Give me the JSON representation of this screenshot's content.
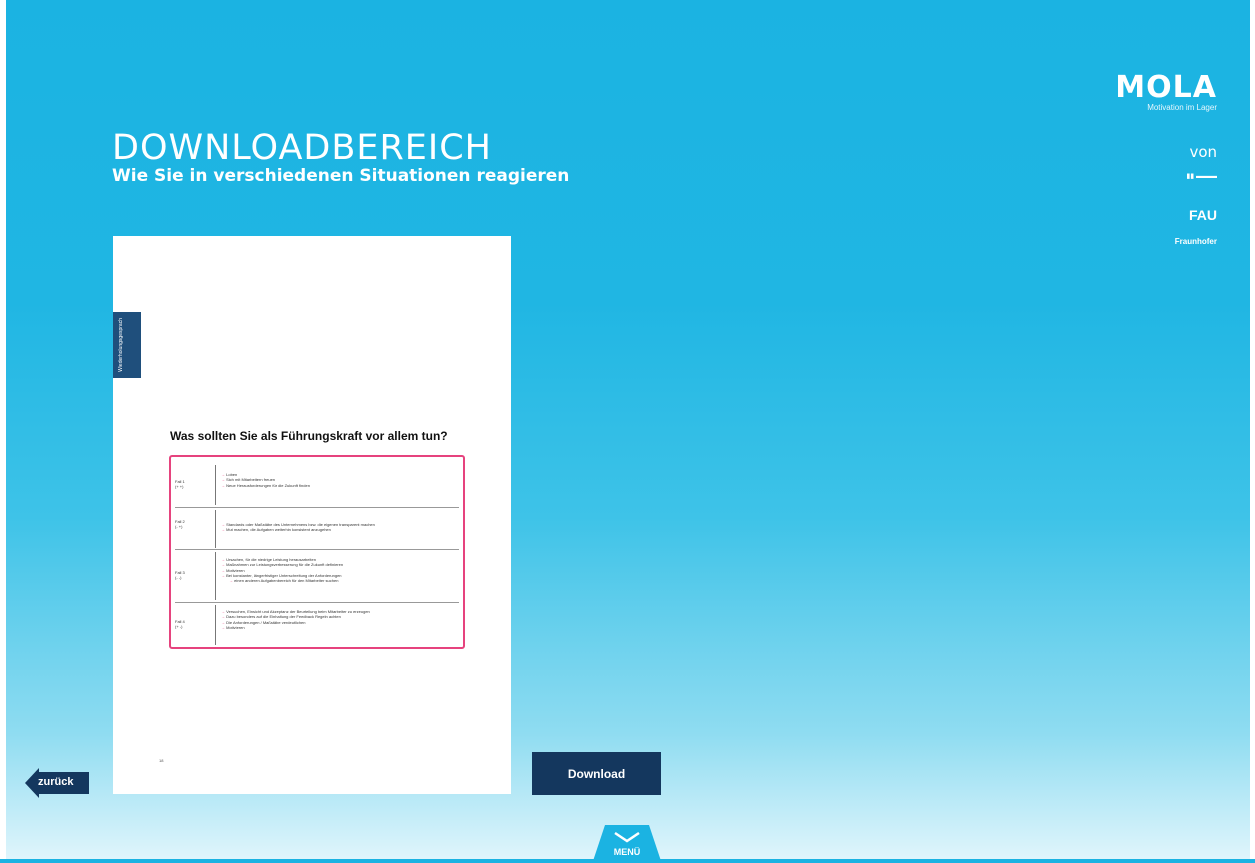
{
  "header": {
    "title": "DOWNLOADBEREICH",
    "subtitle": "Wie Sie in verschiedenen Situationen reagieren"
  },
  "brand": {
    "name": "MOLA",
    "tagline": "Motivation im Lager",
    "von": "von",
    "partners": [
      "FAU",
      "Fraunhofer"
    ]
  },
  "document": {
    "tab_label": "Wiederholungsgesprach",
    "heading": "Was sollten Sie als Führungskraft vor allem tun?",
    "cases": [
      {
        "label": "Fall 1",
        "sub": "(+ +)",
        "items": [
          "Loben",
          "Sich mit Mitarbeitern freuen",
          "Neue Herausforderungen für die Zukunft finden"
        ]
      },
      {
        "label": "Fall 2",
        "sub": "(- +)",
        "items": [
          "Standards oder Maßstäbe des Unternehmens bzw. die eigenen transparent machen",
          "Mut machen, die Aufgaben weiterhin konsistent anzugehen"
        ]
      },
      {
        "label": "Fall 3",
        "sub": "(- -)",
        "items": [
          "Ursachen, für die niedrige Leistung herausarbeiten",
          "Maßnahmen zur Leistungsverbesserung für die Zukunft definieren",
          "Motivieren",
          "Bei konstanter, längerfristiger Unterschreitung der Anforderungen",
          "einen anderen Aufgabenbereich für den Mitarbeiter suchen"
        ]
      },
      {
        "label": "Fall 4",
        "sub": "(+ -)",
        "items": [
          "Versuchen, Einsicht und Akzeptanz der Beurteilung beim Mitarbeiter zu erzeugen",
          "Dazu besonders auf die Einhaltung der Feedback Regeln achten",
          "Die Anforderungen / Maßstäbe verdeutlichen",
          "Motivieren"
        ]
      }
    ],
    "page_number": "18"
  },
  "actions": {
    "download_label": "Download",
    "back_label": "zurück",
    "menu_label": "MENÜ"
  },
  "colors": {
    "accent_dark": "#14375e",
    "highlight": "#e6437e",
    "background": "#1bb3e2"
  }
}
